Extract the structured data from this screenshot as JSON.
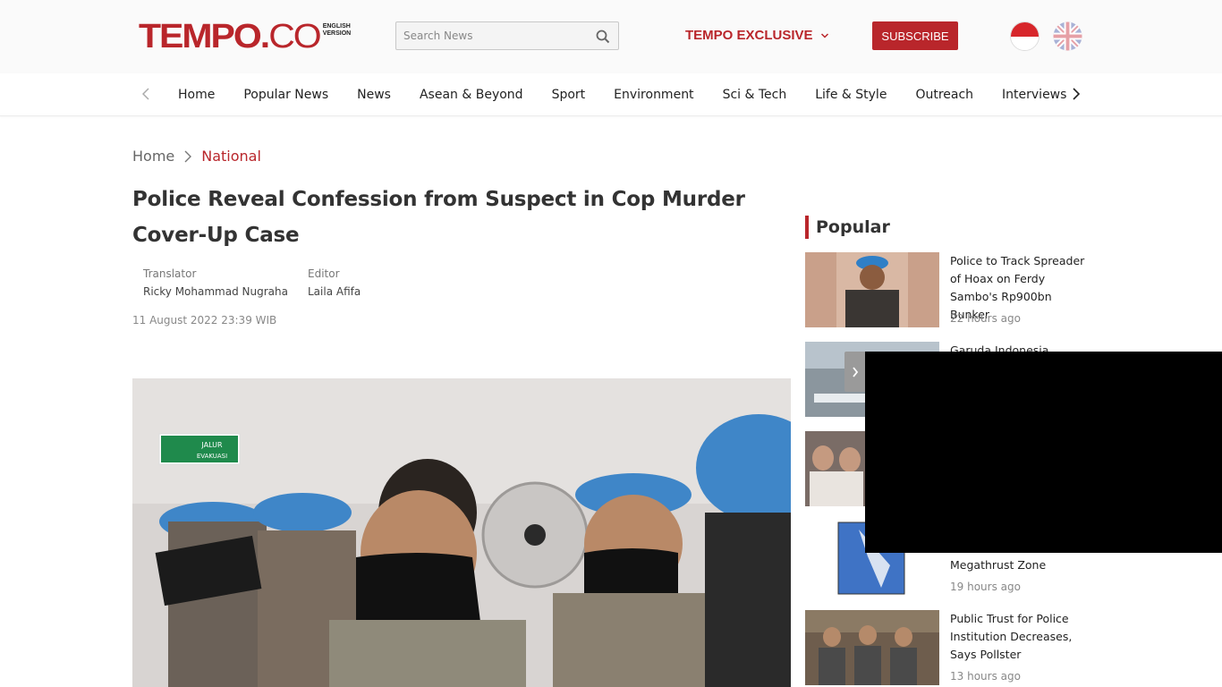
{
  "header": {
    "logo_text": "TEMPO",
    "logo_dot": ".",
    "logo_co": "CO",
    "logo_sub_line1": "ENGLISH",
    "logo_sub_line2": "VERSION",
    "search_placeholder": "Search News",
    "exclusive_label": "TEMPO EXCLUSIVE",
    "subscribe_label": "SUBSCRIBE",
    "brand_color": "#b9262b"
  },
  "nav": {
    "items": [
      "Home",
      "Popular News",
      "News",
      "Asean & Beyond",
      "Sport",
      "Environment",
      "Sci & Tech",
      "Life & Style",
      "Outreach",
      "Interviews"
    ]
  },
  "breadcrumb": {
    "home": "Home",
    "category": "National"
  },
  "article": {
    "title": "Police Reveal Confession from Suspect in Cop Murder Cover-Up Case",
    "translator_role": "Translator",
    "translator_name": "Ricky Mohammad Nugraha",
    "editor_role": "Editor",
    "editor_name": "Laila Afifa",
    "date": "11 August 2022 23:39 WIB",
    "hero_sign_line1": "JALUR",
    "hero_sign_line2": "EVAKUASI"
  },
  "popular": {
    "heading": "Popular",
    "items": [
      {
        "title": "Police to Track Spreader of Hoax on Ferdy Sambo's Rp900bn Bunker",
        "time": "22 hours ago"
      },
      {
        "title": "Garuda Indonesia, Citilink",
        "time": ""
      },
      {
        "title": "",
        "time": ""
      },
      {
        "title": "Megathrust Zone",
        "time": "19 hours ago"
      },
      {
        "title": "Public Trust for Police Institution Decreases, Says Pollster",
        "time": "13 hours ago"
      }
    ]
  }
}
